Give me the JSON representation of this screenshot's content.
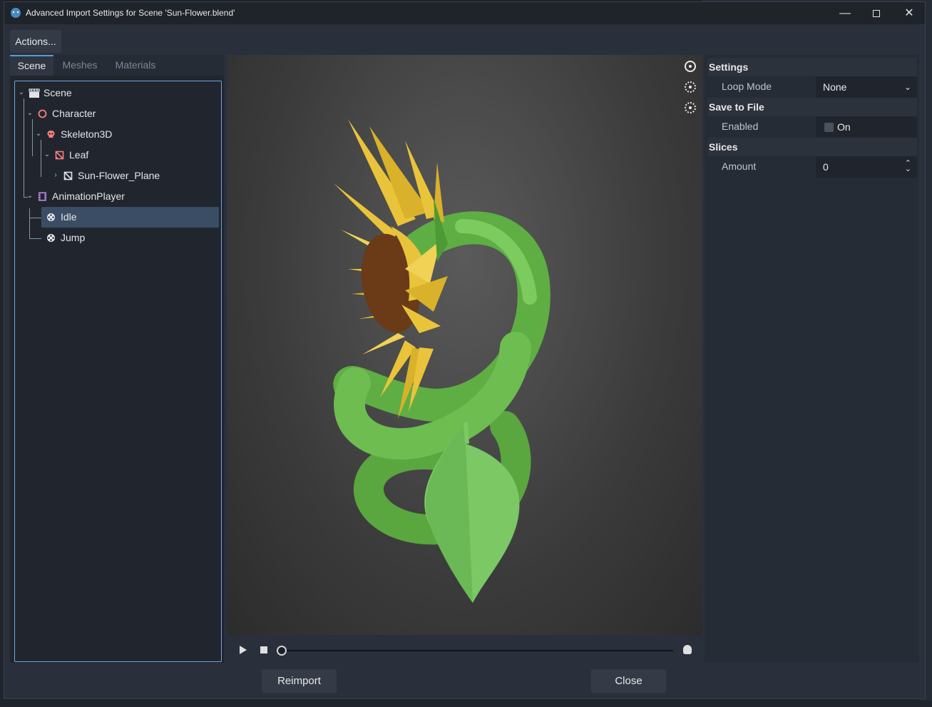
{
  "window": {
    "title": "Advanced Import Settings for Scene 'Sun-Flower.blend'",
    "minimize_glyph": "—",
    "close_glyph": "✕"
  },
  "actions_label": "Actions...",
  "tabs": [
    {
      "label": "Scene",
      "active": true
    },
    {
      "label": "Meshes",
      "active": false
    },
    {
      "label": "Materials",
      "active": false
    }
  ],
  "tree": {
    "scene": "Scene",
    "character": "Character",
    "skeleton": "Skeleton3D",
    "leaf": "Leaf",
    "plane": "Sun-Flower_Plane",
    "animation_player": "AnimationPlayer",
    "idle": "Idle",
    "jump": "Jump",
    "selected": "Idle"
  },
  "settings": {
    "section_settings": "Settings",
    "loop_mode_label": "Loop Mode",
    "loop_mode_value": "None",
    "section_save": "Save to File",
    "enabled_label": "Enabled",
    "enabled_value": "On",
    "section_slices": "Slices",
    "amount_label": "Amount",
    "amount_value": "0"
  },
  "playback": {
    "position_fraction": 0
  },
  "buttons": {
    "reimport": "Reimport",
    "close": "Close"
  },
  "colors": {
    "accent": "#6ea7e3",
    "selection": "#3a4d64",
    "node_red": "#fc7f7f",
    "node_purple": "#c38ef1"
  }
}
